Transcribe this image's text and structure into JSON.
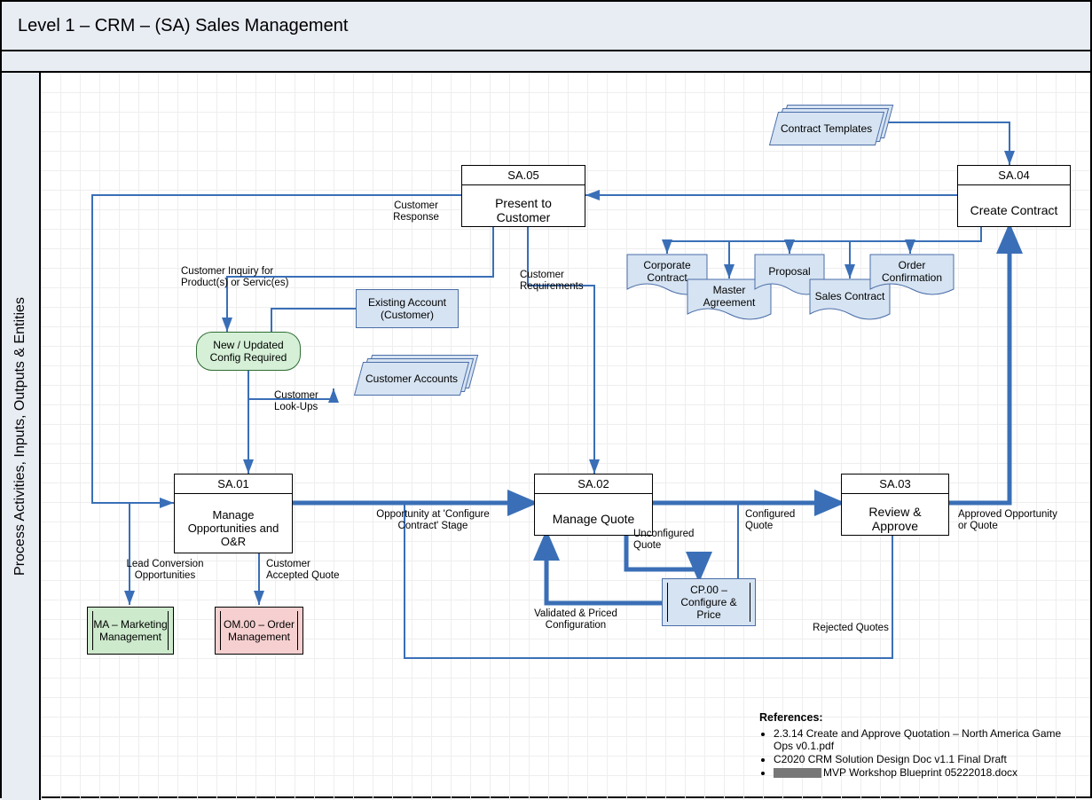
{
  "header": {
    "title": "Level 1 – CRM – (SA) Sales Management"
  },
  "swimlane": {
    "label": "Process Activities, Inputs, Outputs & Entities"
  },
  "processes": {
    "sa01": {
      "code": "SA.01",
      "name": "Manage Opportunities and O&R"
    },
    "sa02": {
      "code": "SA.02",
      "name": "Manage Quote"
    },
    "sa03": {
      "code": "SA.03",
      "name": "Review & Approve"
    },
    "sa04": {
      "code": "SA.04",
      "name": "Create Contract"
    },
    "sa05": {
      "code": "SA.05",
      "name": "Present to Customer"
    }
  },
  "nodes": {
    "new_updated_config": "New / Updated Config Required",
    "existing_account": "Existing Account (Customer)",
    "customer_accounts": "Customer Accounts",
    "contract_templates": "Contract Templates",
    "cp00": "CP.00 – Configure & Price",
    "ma": "MA – Marketing Management",
    "om": "OM.00 – Order Management",
    "docs": {
      "corporate_contract": "Corporate Contract",
      "master_agreement": "Master Agreement",
      "proposal": "Proposal",
      "sales_contract": "Sales Contract",
      "order_confirmation": "Order Confirmation"
    }
  },
  "labels": {
    "customer_response": "Customer Response",
    "customer_inquiry": "Customer Inquiry for Product(s) or Servic(es)",
    "customer_requirements": "Customer Requirements",
    "customer_lookups": "Customer Look-Ups",
    "opportunity_stage": "Opportunity at 'Configure Contract' Stage",
    "unconfigured_quote": "Unconfigured Quote",
    "configured_quote": "Configured Quote",
    "validated_priced": "Validated & Priced Configuration",
    "rejected_quotes": "Rejected Quotes",
    "approved_opp": "Approved Opportunity or Quote",
    "lead_conv": "Lead Conversion Opportunities",
    "cust_accepted_quote": "Customer Accepted Quote"
  },
  "references": {
    "heading": "References:",
    "items": [
      "2.3.14 Create and Approve Quotation – North America Game Ops v0.1.pdf",
      "C2020 CRM Solution Design Doc v1.1 Final Draft",
      "MVP Workshop Blueprint 05222018.docx"
    ]
  }
}
